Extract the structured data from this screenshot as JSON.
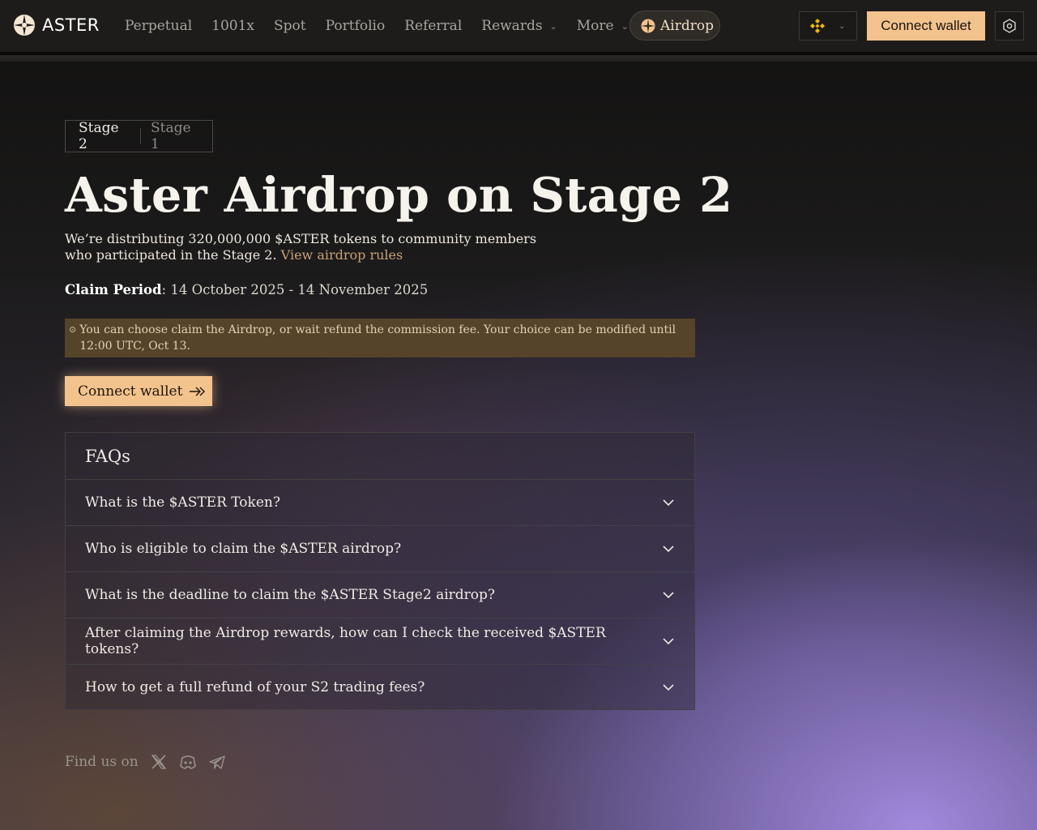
{
  "header": {
    "logo_text": "ASTER",
    "nav": [
      {
        "label": "Perpetual",
        "dropdown": false
      },
      {
        "label": "1001x",
        "dropdown": false
      },
      {
        "label": "Spot",
        "dropdown": false
      },
      {
        "label": "Portfolio",
        "dropdown": false
      },
      {
        "label": "Referral",
        "dropdown": false
      },
      {
        "label": "Rewards",
        "dropdown": true
      },
      {
        "label": "More",
        "dropdown": true
      }
    ],
    "airdrop_label": "Airdrop",
    "chain_icon": "bnb-chain-icon",
    "connect_label": "Connect wallet",
    "settings_icon": "settings-icon"
  },
  "stages": {
    "active": "Stage 2",
    "inactive": "Stage 1"
  },
  "hero": {
    "title": "Aster Airdrop on Stage 2",
    "desc_line1": "We’re distributing 320,000,000 $ASTER tokens to community members",
    "desc_line2": "who participated in the Stage 2.",
    "rules_link": "View airdrop rules",
    "claim_label": "Claim Period",
    "claim_value": ": 14 October 2025 - 14 November 2025",
    "notice": "You can choose claim the Airdrop, or wait refund the commission fee. Your choice can be modified until 12:00 UTC, Oct 13.",
    "connect_label": "Connect wallet"
  },
  "faq": {
    "title": "FAQs",
    "items": [
      "What is the $ASTER Token?",
      "Who is eligible to claim the $ASTER airdrop?",
      "What is the deadline to claim the $ASTER Stage2 airdrop?",
      "After claiming the Airdrop rewards, how can I check the received $ASTER tokens?",
      "How to get a full refund of your S2 trading fees?"
    ]
  },
  "footer": {
    "label": "Find us on",
    "socials": [
      "x-icon",
      "discord-icon",
      "telegram-icon"
    ]
  },
  "colors": {
    "accent": "#f3c38e",
    "link": "#c9a276",
    "notice_bg": "#55432a"
  }
}
